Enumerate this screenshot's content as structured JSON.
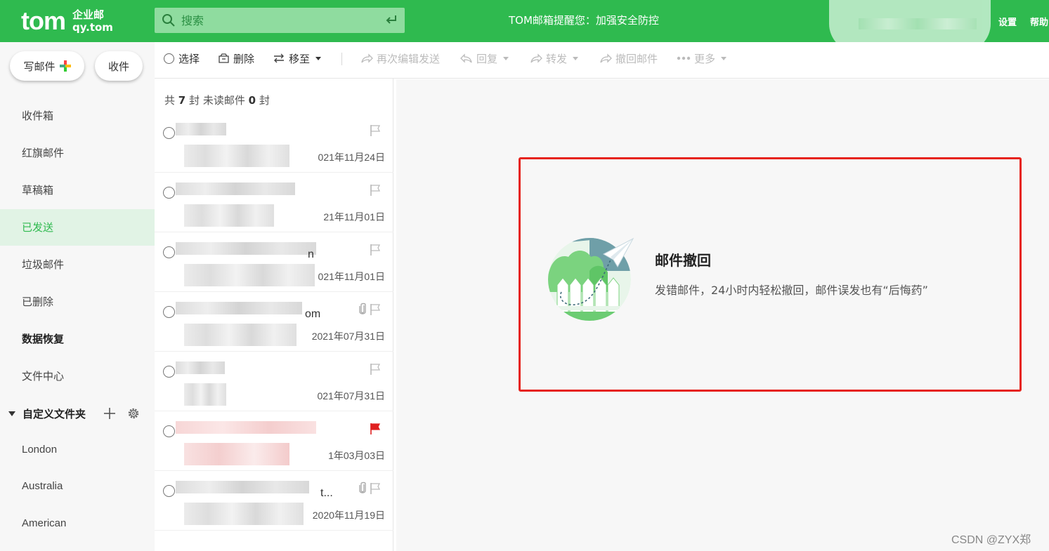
{
  "header": {
    "logo_main": "tom",
    "logo_line1": "企业邮",
    "logo_line2": "qy.tom",
    "search_placeholder": "搜索",
    "notice": "TOM邮箱提醒您：加强安全防控",
    "settings": "设置",
    "help": "帮助"
  },
  "sidebar": {
    "compose_label": "写邮件",
    "receive_label": "收件",
    "items": [
      {
        "label": "收件箱"
      },
      {
        "label": "红旗邮件"
      },
      {
        "label": "草稿箱"
      },
      {
        "label": "已发送"
      },
      {
        "label": "垃圾邮件"
      },
      {
        "label": "已删除"
      },
      {
        "label": "数据恢复"
      },
      {
        "label": "文件中心"
      }
    ],
    "active_item": "已发送",
    "custom_folder_label": "自定义文件夹",
    "custom_folders": [
      "London",
      "Australia",
      "American"
    ]
  },
  "toolbar": {
    "select": "选择",
    "delete": "删除",
    "move_to": "移至",
    "reedit_send": "再次编辑发送",
    "reply": "回复",
    "forward": "转发",
    "recall": "撤回邮件",
    "more": "更多"
  },
  "maillist": {
    "summary_prefix": "共",
    "total": "7",
    "summary_mid": "封",
    "unread_label": "未读邮件",
    "unread": "0",
    "summary_suffix": "封",
    "rows": [
      {
        "tail": "",
        "date": "021年11月24日",
        "flagged": false,
        "attachment": false
      },
      {
        "tail": "",
        "date": "21年11月01日",
        "flagged": false,
        "attachment": false
      },
      {
        "tail": "n",
        "date": "021年11月01日",
        "flagged": false,
        "attachment": false
      },
      {
        "tail": "om",
        "date": "2021年07月31日",
        "flagged": false,
        "attachment": true
      },
      {
        "tail": "",
        "date": "021年07月31日",
        "flagged": false,
        "attachment": false
      },
      {
        "tail": "",
        "date": "1年03月03日",
        "flagged": true,
        "attachment": false
      },
      {
        "tail": "t...",
        "date": "2020年11月19日",
        "flagged": false,
        "attachment": true
      }
    ]
  },
  "promo": {
    "title": "邮件撤回",
    "description": "发错邮件，24小时内轻松撤回，邮件误发也有“后悔药”"
  },
  "colors": {
    "brand_green": "#2fba4f",
    "highlight_red": "#e6231c",
    "flag_red": "#e02020"
  },
  "watermark": "CSDN @ZYX郑"
}
